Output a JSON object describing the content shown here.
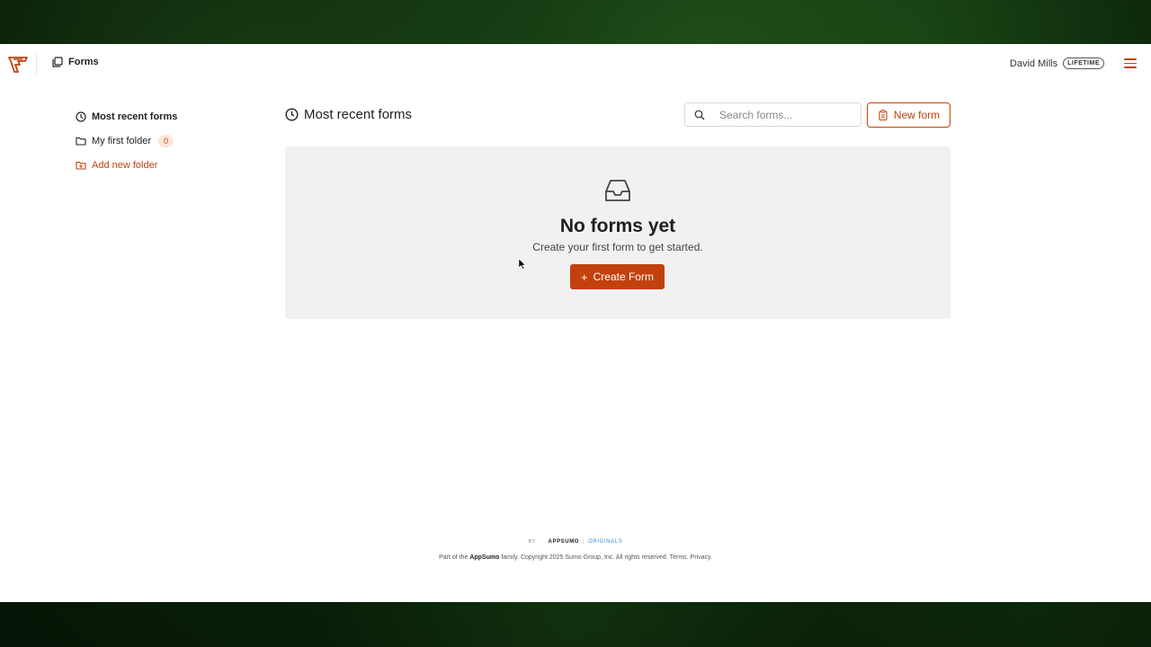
{
  "header": {
    "app_title": "Forms",
    "user_name": "David Mills",
    "plan_badge": "LIFETIME"
  },
  "sidebar": {
    "items": [
      {
        "label": "Most recent forms",
        "icon": "clock-icon"
      },
      {
        "label": "My first folder",
        "icon": "folder-icon",
        "count": "0"
      },
      {
        "label": "Add new folder",
        "icon": "folder-plus-icon"
      }
    ]
  },
  "main": {
    "title": "Most recent forms",
    "search_placeholder": "Search forms...",
    "new_form_label": "New form",
    "empty_title": "No forms yet",
    "empty_subtitle": "Create your first form to get started.",
    "create_button_label": "Create Form"
  },
  "footer": {
    "by": "BY",
    "brand": "APPSUMO",
    "separator": "|",
    "originals": "ORIGINALS",
    "text_prefix": "Part of the ",
    "text_brand": "AppSumo",
    "text_suffix": " family. Copyright 2025 Sumo Group, Inc. All rights reserved. Terms. Privacy."
  },
  "colors": {
    "accent": "#c2410c",
    "panel_bg": "#f1f1f1"
  }
}
